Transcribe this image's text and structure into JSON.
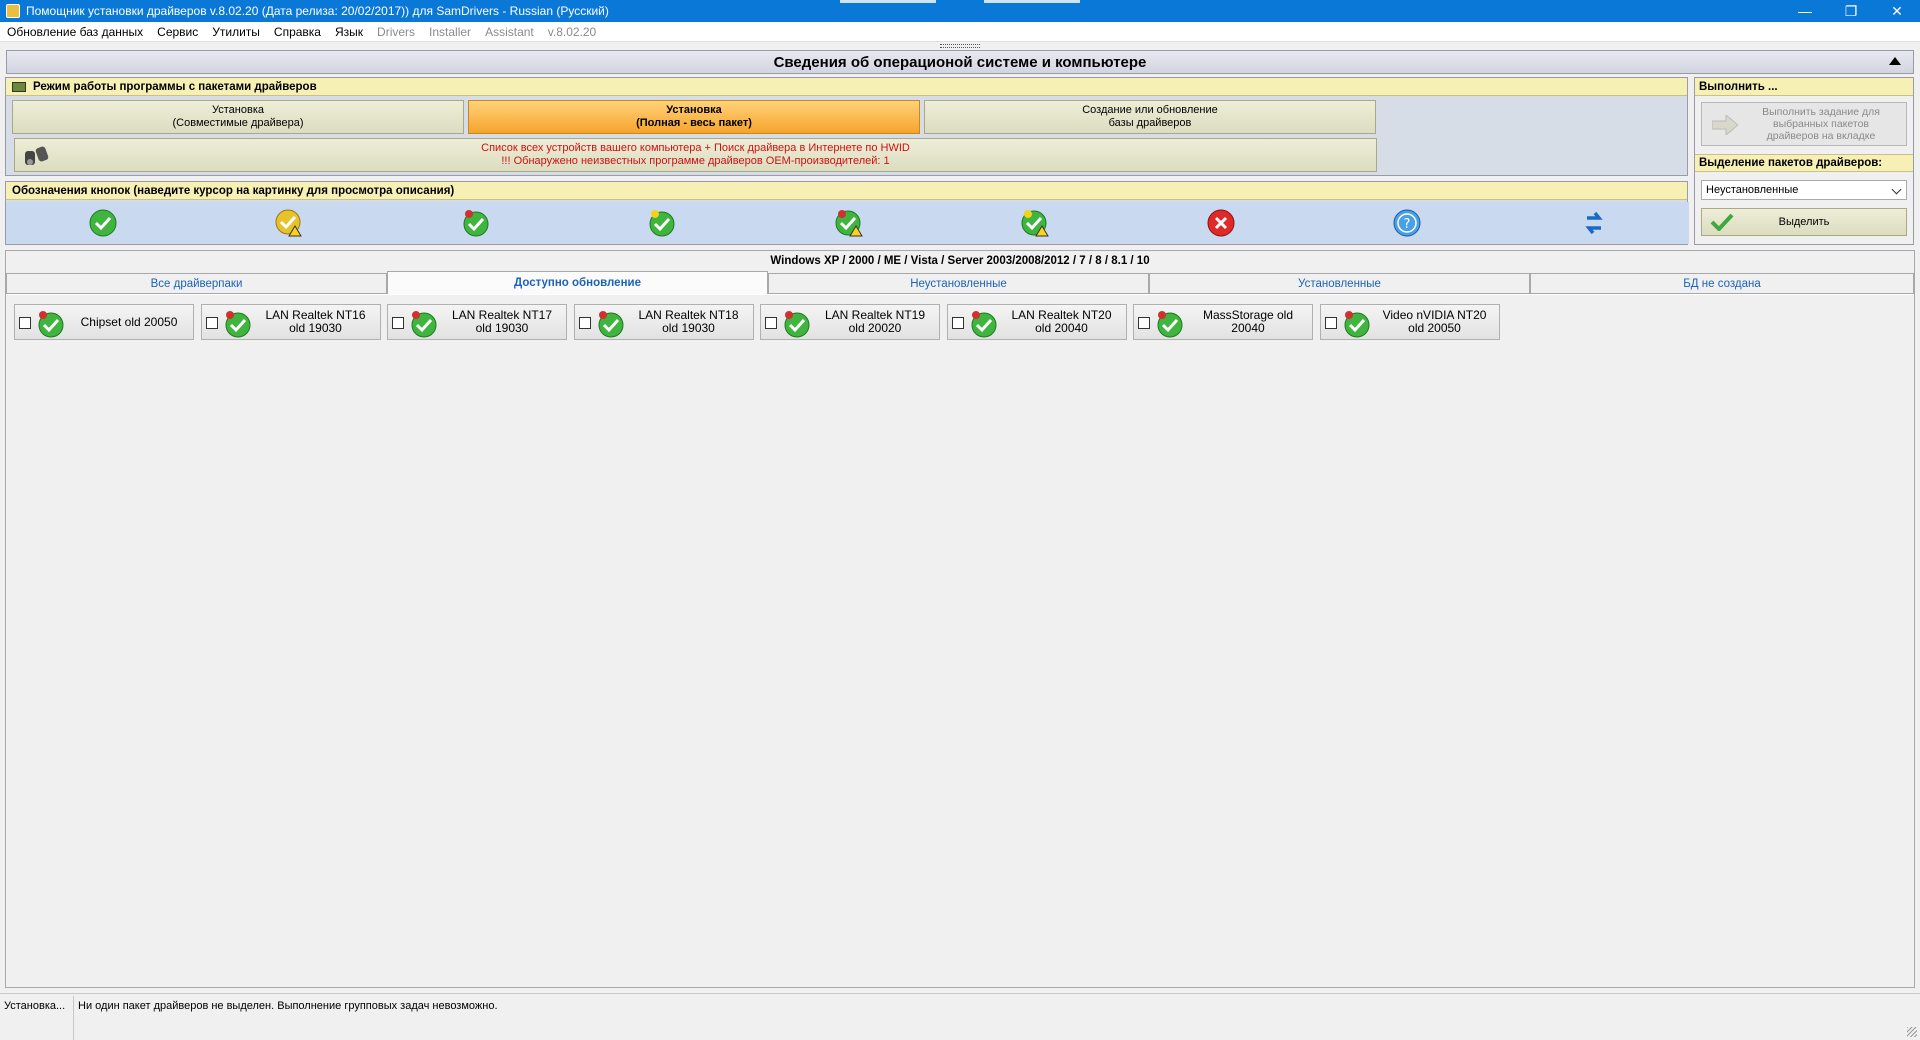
{
  "window": {
    "title": "Помощник установки драйверов v.8.02.20 (Дата релиза: 20/02/2017)) для SamDrivers - Russian (Русский)",
    "controls": [
      "minimize",
      "restore",
      "close"
    ]
  },
  "menu": [
    {
      "label": "Обновление баз данных",
      "enabled": true
    },
    {
      "label": "Сервис",
      "enabled": true
    },
    {
      "label": "Утилиты",
      "enabled": true
    },
    {
      "label": "Справка",
      "enabled": true
    },
    {
      "label": "Язык",
      "enabled": true
    },
    {
      "label": "Drivers",
      "enabled": false
    },
    {
      "label": "Installer",
      "enabled": false
    },
    {
      "label": "Assistant",
      "enabled": false
    },
    {
      "label": "v.8.02.20",
      "enabled": false
    }
  ],
  "os_header": {
    "title": "Сведения об операционой системе и компьютере"
  },
  "mode": {
    "heading": "Режим работы программы с пакетами драйверов",
    "buttons": [
      {
        "line1": "Установка",
        "line2": "(Совместимые драйвера)",
        "active": false
      },
      {
        "line1": "Установка",
        "line2": "(Полная - весь пакет)",
        "active": true
      },
      {
        "line1": "Создание или обновление",
        "line2": "базы драйверов",
        "active": false
      }
    ],
    "device_list": {
      "line1": "Список всех устройств вашего компьютера + Поиск драйвера в Интернете по HWID",
      "line2": "!!! Обнаружено неизвестных программе драйверов OEM-производителей: 1"
    }
  },
  "legend": {
    "heading": "Обозначения кнопок (наведите курсор на картинку для просмотра описания)",
    "icons": [
      "ok-check-icon",
      "check-warning-icon",
      "update-check-icon",
      "check-bulb-icon",
      "update-warning-icon",
      "check-bulb-warning-icon",
      "error-x-icon",
      "help-question-icon",
      "refresh-arrows-icon"
    ]
  },
  "right": {
    "execute_heading": "Выполнить ...",
    "execute_button": "Выполнить задание для выбранных пакетов драйверов на вкладке",
    "select_heading": "Выделение пакетов драйверов:",
    "select_value": "Неустановленные",
    "select_button": "Выделить"
  },
  "tabs_area": {
    "os_line": "Windows XP / 2000 / ME / Vista / Server 2003/2008/2012 / 7 / 8 / 8.1 / 10",
    "tabs": [
      {
        "label": "Все драйверпаки",
        "active": false
      },
      {
        "label": "Доступно обновление",
        "active": true
      },
      {
        "label": "Неустановленные",
        "active": false
      },
      {
        "label": "Установленные",
        "active": false
      },
      {
        "label": "БД не создана",
        "active": false
      }
    ],
    "packages": [
      {
        "label": "Chipset old 20050",
        "checked": false
      },
      {
        "label": "LAN Realtek NT16\nold 19030",
        "checked": false
      },
      {
        "label": "LAN Realtek NT17\nold 19030",
        "checked": false
      },
      {
        "label": "LAN Realtek NT18\nold 19030",
        "checked": false
      },
      {
        "label": "LAN Realtek NT19\nold 20020",
        "checked": false
      },
      {
        "label": "LAN Realtek NT20\nold 20040",
        "checked": false
      },
      {
        "label": "MassStorage old\n20040",
        "checked": false
      },
      {
        "label": "Video nVIDIA NT20\nold 20050",
        "checked": false
      }
    ]
  },
  "status": {
    "left": "Установка...",
    "message": "Ни один пакет драйверов не выделен. Выполнение групповых задач невозможно."
  },
  "colors": {
    "titlebar": "#0a78d7",
    "active_mode": "#f6a42c",
    "heading_yellow": "#f6f0b4",
    "legend_blue": "#c9d9ef",
    "warning_red": "#d01010",
    "tab_text": "#1a63b8"
  }
}
